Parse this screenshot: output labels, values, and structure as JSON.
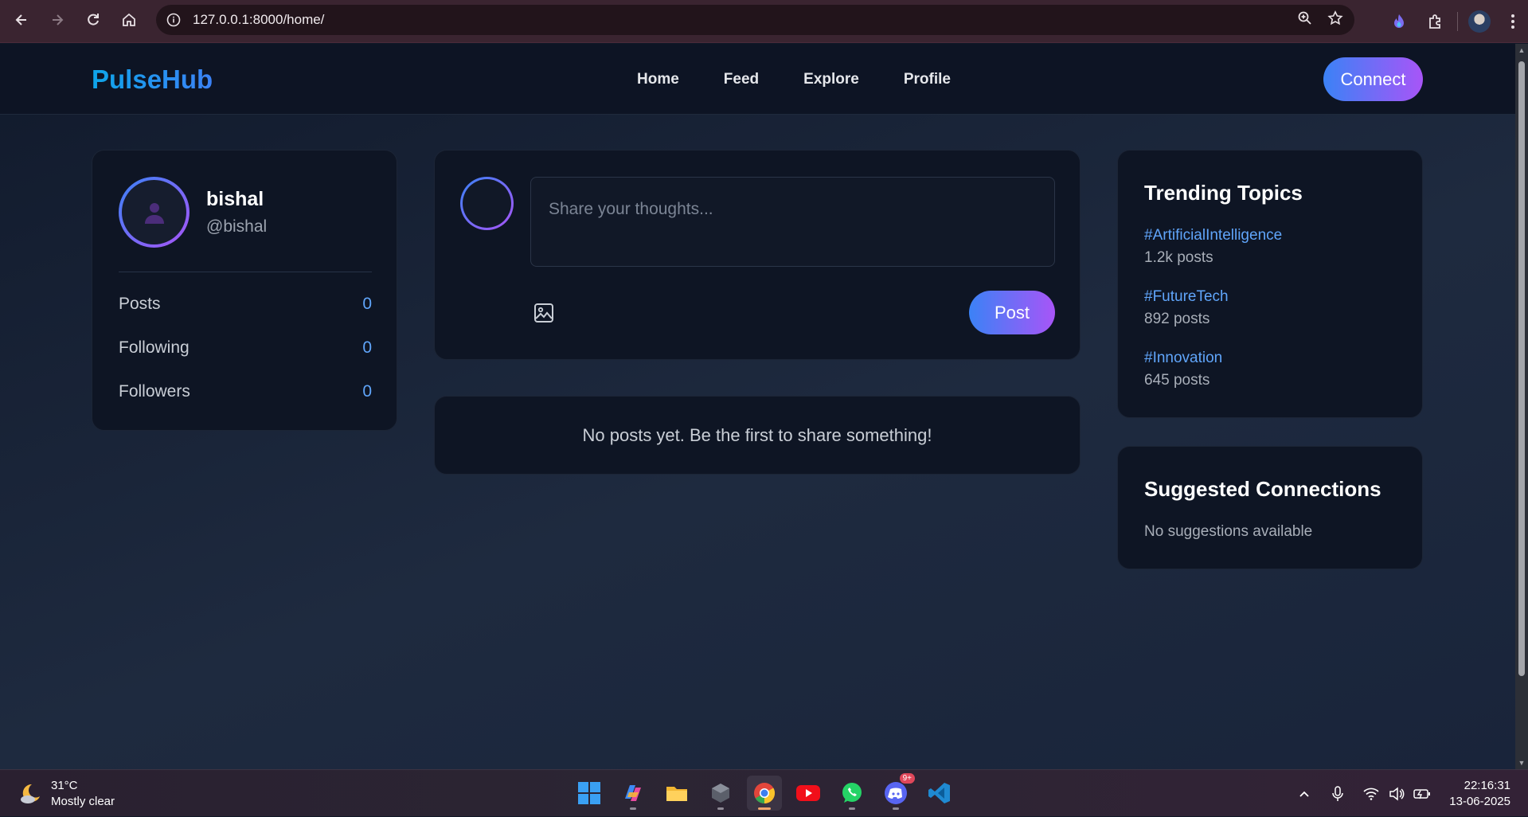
{
  "browser": {
    "url": "127.0.0.1:8000/home/"
  },
  "app": {
    "brand": "PulseHub",
    "nav": [
      "Home",
      "Feed",
      "Explore",
      "Profile"
    ],
    "connect_label": "Connect"
  },
  "profile": {
    "name": "bishal",
    "handle": "@bishal",
    "stats": [
      {
        "label": "Posts",
        "value": "0"
      },
      {
        "label": "Following",
        "value": "0"
      },
      {
        "label": "Followers",
        "value": "0"
      }
    ]
  },
  "composer": {
    "placeholder": "Share your thoughts...",
    "post_label": "Post"
  },
  "feed": {
    "empty_message": "No posts yet. Be the first to share something!"
  },
  "trending": {
    "title": "Trending Topics",
    "items": [
      {
        "tag": "#ArtificialIntelligence",
        "count": "1.2k posts"
      },
      {
        "tag": "#FutureTech",
        "count": "892 posts"
      },
      {
        "tag": "#Innovation",
        "count": "645 posts"
      }
    ]
  },
  "suggestions": {
    "title": "Suggested Connections",
    "empty_message": "No suggestions available"
  },
  "taskbar": {
    "temperature": "31°C",
    "weather": "Mostly clear",
    "time": "22:16:31",
    "date": "13-06-2025",
    "discord_badge": "9+"
  },
  "colors": {
    "accent_start": "#3b82f6",
    "accent_end": "#a855f7",
    "link": "#60a5fa",
    "card_bg": "#0e1524"
  }
}
